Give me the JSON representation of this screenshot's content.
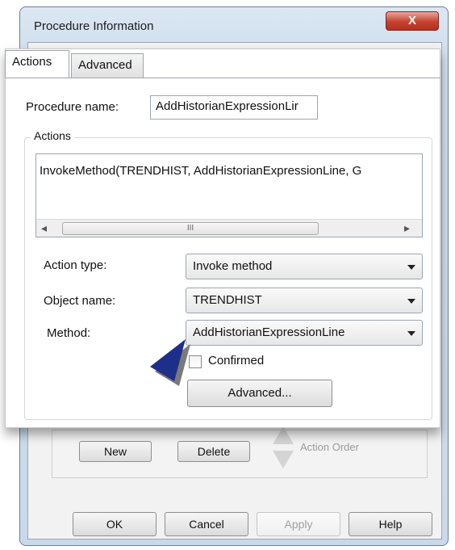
{
  "window": {
    "title": "Procedure Information",
    "close_label": "X"
  },
  "tabs": [
    {
      "label": "Actions"
    },
    {
      "label": "Advanced"
    }
  ],
  "procedure_name": {
    "label": "Procedure name:",
    "value": "AddHistorianExpressionLir"
  },
  "actions_group": {
    "legend": "Actions",
    "list_item": "InvokeMethod(TRENDHIST, AddHistorianExpressionLine, G",
    "scroll_left": "◂",
    "scroll_right": "▸",
    "scroll_grip": "III"
  },
  "action_type": {
    "label": "Action type:",
    "value": "Invoke method"
  },
  "object_name": {
    "label": "Object name:",
    "value": "TRENDHIST"
  },
  "method": {
    "label": "Method:",
    "value": "AddHistorianExpressionLine"
  },
  "confirmed": {
    "label": "Confirmed",
    "checked": false
  },
  "advanced_button": "Advanced...",
  "lower": {
    "new_button": "New",
    "delete_button": "Delete",
    "action_order_label": "Action Order"
  },
  "footer": {
    "ok": "OK",
    "cancel": "Cancel",
    "apply": "Apply",
    "help": "Help"
  },
  "colors": {
    "pointer_arrow": "#1e2f8a",
    "close_button": "#c7412f"
  },
  "icons": [
    "close-icon",
    "scroll-left-icon",
    "scroll-right-icon",
    "chevron-down-icon",
    "pointer-arrow-icon",
    "up-arrow-icon",
    "down-arrow-icon"
  ]
}
